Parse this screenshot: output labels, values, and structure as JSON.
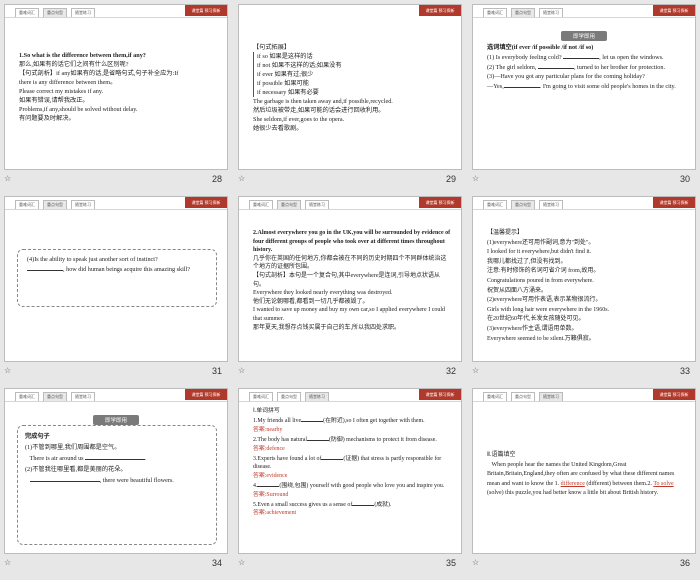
{
  "brand": "课堂篇 预习探新",
  "tabs": [
    "重难词汇",
    "重点句型",
    "随堂练习"
  ],
  "active_tab_index": 1,
  "pill_label": "即学即用",
  "slides": [
    {
      "number": "28",
      "lines": [
        "1.So what is the difference between them,if any?",
        "那么,如果有的话它们之间有什么区别呢?",
        "【句式剖析】if any如果有的话,是省略句式,句子补全应为:If",
        "there is any difference between them。",
        "Please correct my mistakes if any.",
        "如果有错误,请帮我改正。",
        "Problems,if any,should be solved without delay.",
        "有问题要及时解决。"
      ]
    },
    {
      "number": "29",
      "heading": "【句式拓展】",
      "bracket": [
        "if so 如果是这样的话",
        "if not 如果不这样的话;如果没有",
        "if ever 如果有过;很少",
        "if possible 如果可能",
        "if necessary 如果有必要"
      ],
      "lines": [
        "The garbage is then taken away and,if possible,recycled.",
        "然后垃圾被带走,如果可能的话会进行回收利用。",
        "She seldom,if ever,goes to the opera.",
        "她很少去看歌剧。"
      ]
    },
    {
      "number": "30",
      "title": "选词填空(if ever /if possible /if not /if so)",
      "items": [
        "(1) Is everybody feeling cold?",
        ", let us open the windows.",
        "(2) The girl seldom,",
        ", turned to her brother for protection.",
        "(3)—Have you got any particular plans for the coming holiday?",
        "—Yes,",
        ". I'm going to visit some old people's homes in the city."
      ]
    },
    {
      "number": "31",
      "lines": [
        "(4)Is the ability to speak just another sort of instinct?",
        ", how did human beings acquire this amazing skill?"
      ]
    },
    {
      "number": "32",
      "lines": [
        "2.Almost everywhere you go in the UK,you will be surrounded by evidence of four different groups of people who took over at different times throughout history.",
        "几乎你在英国的任何地方,你都会被在不同的历史时期四个不同群体统治这个地方的证据所包围。",
        "【句式剖析】本句是一个复合句,其中everywhere是连词,引导地点状语从句。",
        "Everywhere they looked nearly everything was destroyed.",
        "他们无论朝哪看,都看到一切几乎都被毁了。",
        "I wanted to save up money and buy my own car,so I applied everywhere I could that summer.",
        "那年夏天,我想存点钱买属于自己的车,所以我四处求职。"
      ]
    },
    {
      "number": "33",
      "heading": "【温馨提示】",
      "lines": [
        "(1)everywhere还可用作副词,意为\"到处\"。",
        "I looked for it everywhere,but didn't find it.",
        "我哪儿都找过了,但没有找到。",
        "注意:有时修饰的名词可省介词 from,故用。",
        "Congratulations poured in from everywhere.",
        "祝贺从四面八方涌来。",
        "(2)everywhere可用作表语,表示某物很流行。",
        "Girls with long hair were everywhere in the 1960s.",
        "在20世纪60年代,长发女孩随处可见。",
        "(3)everywhere作主语,谓语用单数。",
        "Everywhere seemed to be silent.万籁俱寂。"
      ]
    },
    {
      "number": "34",
      "title": "完成句子",
      "lines": [
        "(1)不管到哪里,我们周围都是空气。",
        "There is air around us",
        ".",
        "(2)不管我往哪里看,都是美丽的花朵。",
        ", there were beautiful flowers."
      ]
    },
    {
      "number": "35",
      "heading": "Ⅰ.单词拼写",
      "lines": [
        "1.My friends all live",
        "(在附近),so I often get together with them.",
        "答案:nearby",
        "2.The body has natural",
        "(防御) mechanisms to protect it from disease.",
        "答案:defence",
        "3.Experts have found a lot of",
        "(证据) that stress is partly responsible for disease.",
        "答案:evidence",
        "4.",
        "(围绕,包围) yourself with good people who love you and inspire you.",
        "答案:Surround",
        "5.Even a small success gives us a sense of",
        "(成就).",
        "答案:achievement"
      ]
    },
    {
      "number": "36",
      "heading": "Ⅱ.语篇填空",
      "text1": "When people hear the names the United Kingdom,Great Britain,Britain,England,they often are confused by what these different names mean and want to know the 1.",
      "ans1": "difference",
      "text2": "(different) between them.2.",
      "ans2": "To solve",
      "text3": "(solve) this puzzle,you had better know a little bit about British history."
    }
  ]
}
